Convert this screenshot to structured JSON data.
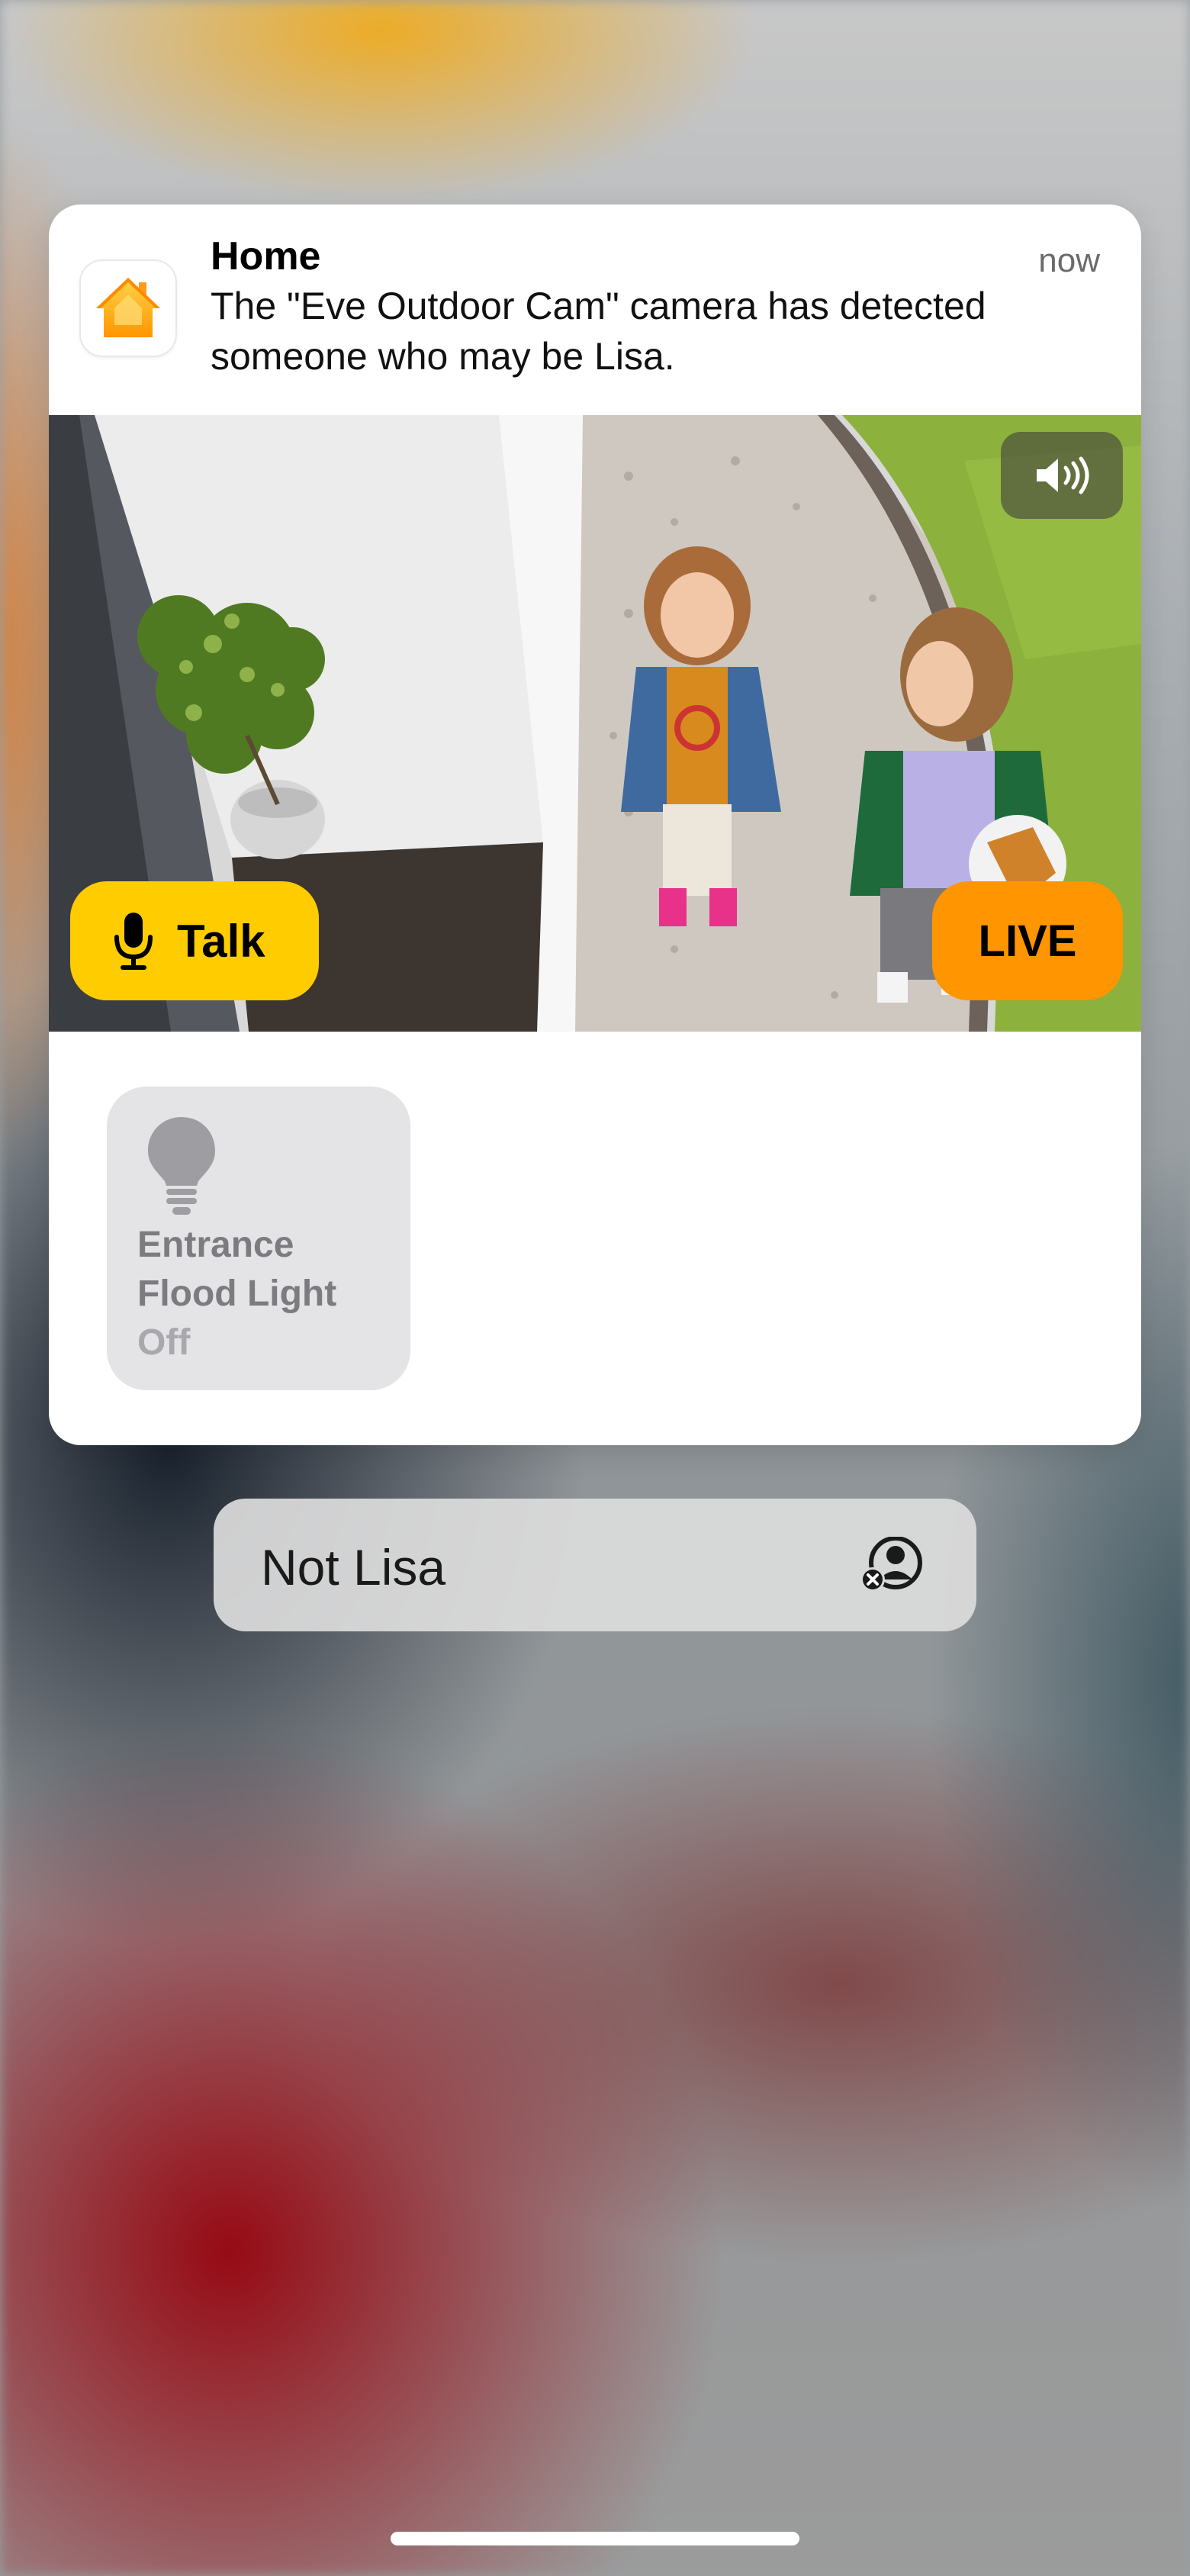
{
  "notification": {
    "app_name": "Home",
    "timestamp": "now",
    "message": "The \"Eve Outdoor Cam\" camera has detected someone who may be Lisa.",
    "app_icon": "home-app-icon"
  },
  "camera": {
    "talk_label": "Talk",
    "live_label": "LIVE",
    "mute_icon": "speaker-wave-icon",
    "mic_icon": "microphone-icon",
    "colors": {
      "talk": "#ffcc00",
      "live": "#ff9500"
    }
  },
  "accessory": {
    "name_line1": "Entrance",
    "name_line2": "Flood Light",
    "status": "Off",
    "icon": "lightbulb-icon"
  },
  "action": {
    "label": "Not Lisa",
    "icon": "person-remove-icon"
  }
}
